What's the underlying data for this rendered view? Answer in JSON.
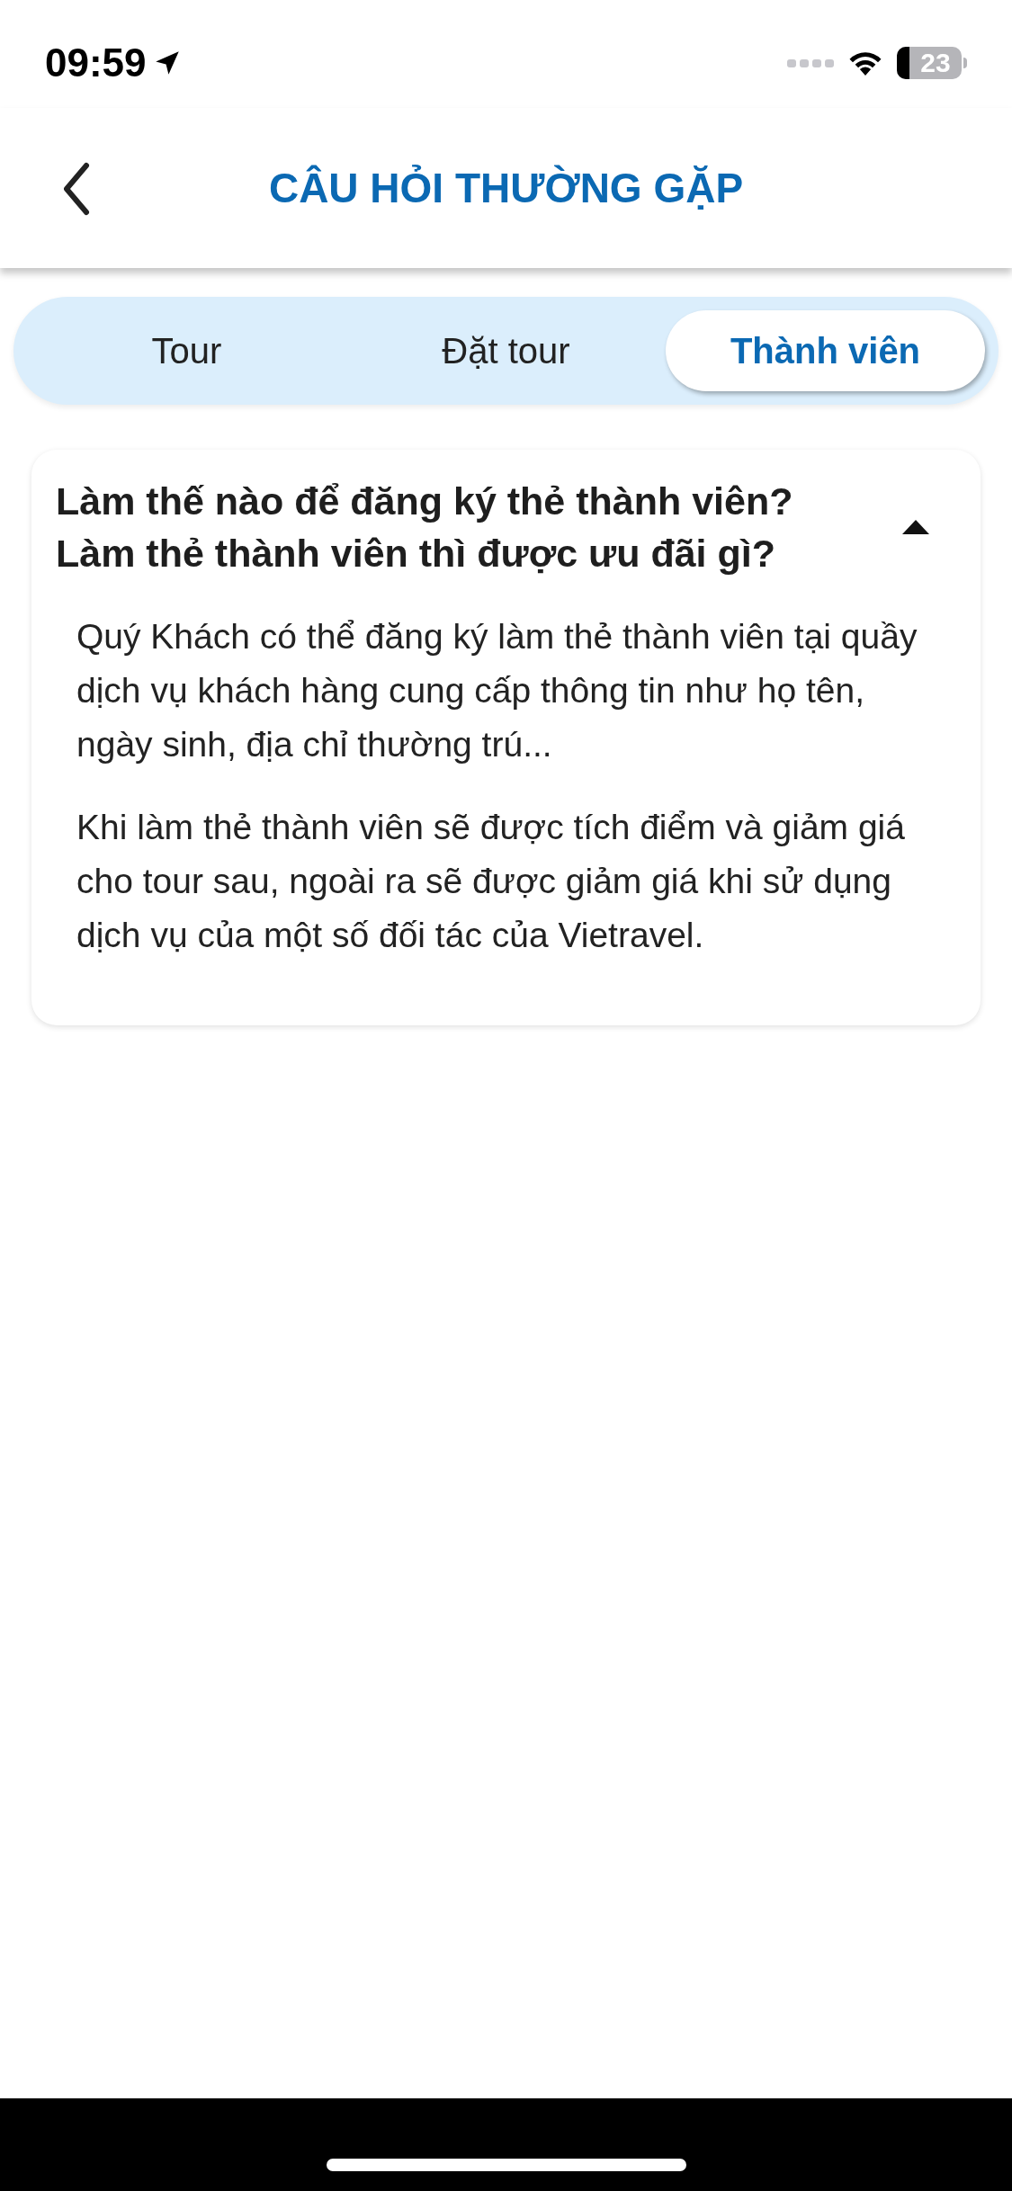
{
  "status_bar": {
    "time": "09:59",
    "battery": "23"
  },
  "header": {
    "title": "CÂU HỎI THƯỜNG GẶP"
  },
  "tabs": [
    {
      "label": "Tour",
      "selected": false
    },
    {
      "label": "Đặt tour",
      "selected": false
    },
    {
      "label": "Thành viên",
      "selected": true
    }
  ],
  "faq": [
    {
      "question": "Làm thế nào để đăng ký thẻ thành viên? Làm thẻ thành viên thì được ưu đãi gì?",
      "expanded": true,
      "answer": [
        "Quý Khách có thể đăng ký làm thẻ thành viên tại quầy dịch vụ khách hàng cung cấp thông tin như họ tên, ngày sinh, địa chỉ thường trú...",
        "Khi làm thẻ thành viên sẽ được tích điểm và giảm giá cho tour sau, ngoài ra sẽ được giảm giá khi sử dụng dịch vụ của một số đối tác của Vietravel."
      ]
    }
  ]
}
